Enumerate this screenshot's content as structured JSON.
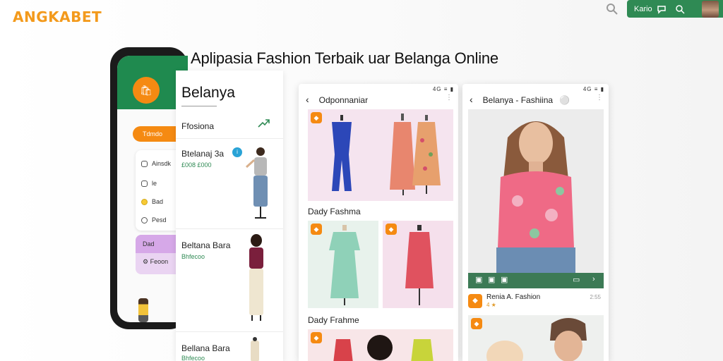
{
  "brand": {
    "logo": "ANGKABET"
  },
  "top_nav": {
    "label": "Kario"
  },
  "headline": "Aplipasia Fashion Terbaik uar Belanga Online",
  "phone": {
    "pill_label": "Tdmdo",
    "rows": [
      "Ainsdk",
      "le",
      "Bad",
      "Pesd"
    ],
    "purple_top": "Dad",
    "purple_bottom": "Feoon"
  },
  "panel1": {
    "title": "Belanya",
    "section": "Ffosiona",
    "items": [
      {
        "name": "Btelanaj 3a",
        "price": "£008 £000"
      },
      {
        "name": "Beltana Bara",
        "price": "Bhfecoo"
      },
      {
        "name": "Bellana Bara",
        "price": "Bhfecoo"
      }
    ]
  },
  "screen2": {
    "status": "4G ≡ ▮",
    "header": "Odponnaniar",
    "label1": "Dady Fashma",
    "label2": "Dady Frahme"
  },
  "screen3": {
    "status": "4G ≡ ▮",
    "header": "Belanya - Fashiina",
    "row_title": "Renia A. Fashion",
    "row_sub": "4 ★",
    "row_right": "2:55"
  },
  "colors": {
    "brand_orange": "#f58a12",
    "brand_green": "#2f8a54",
    "status_blue": "#2aa3d6"
  }
}
